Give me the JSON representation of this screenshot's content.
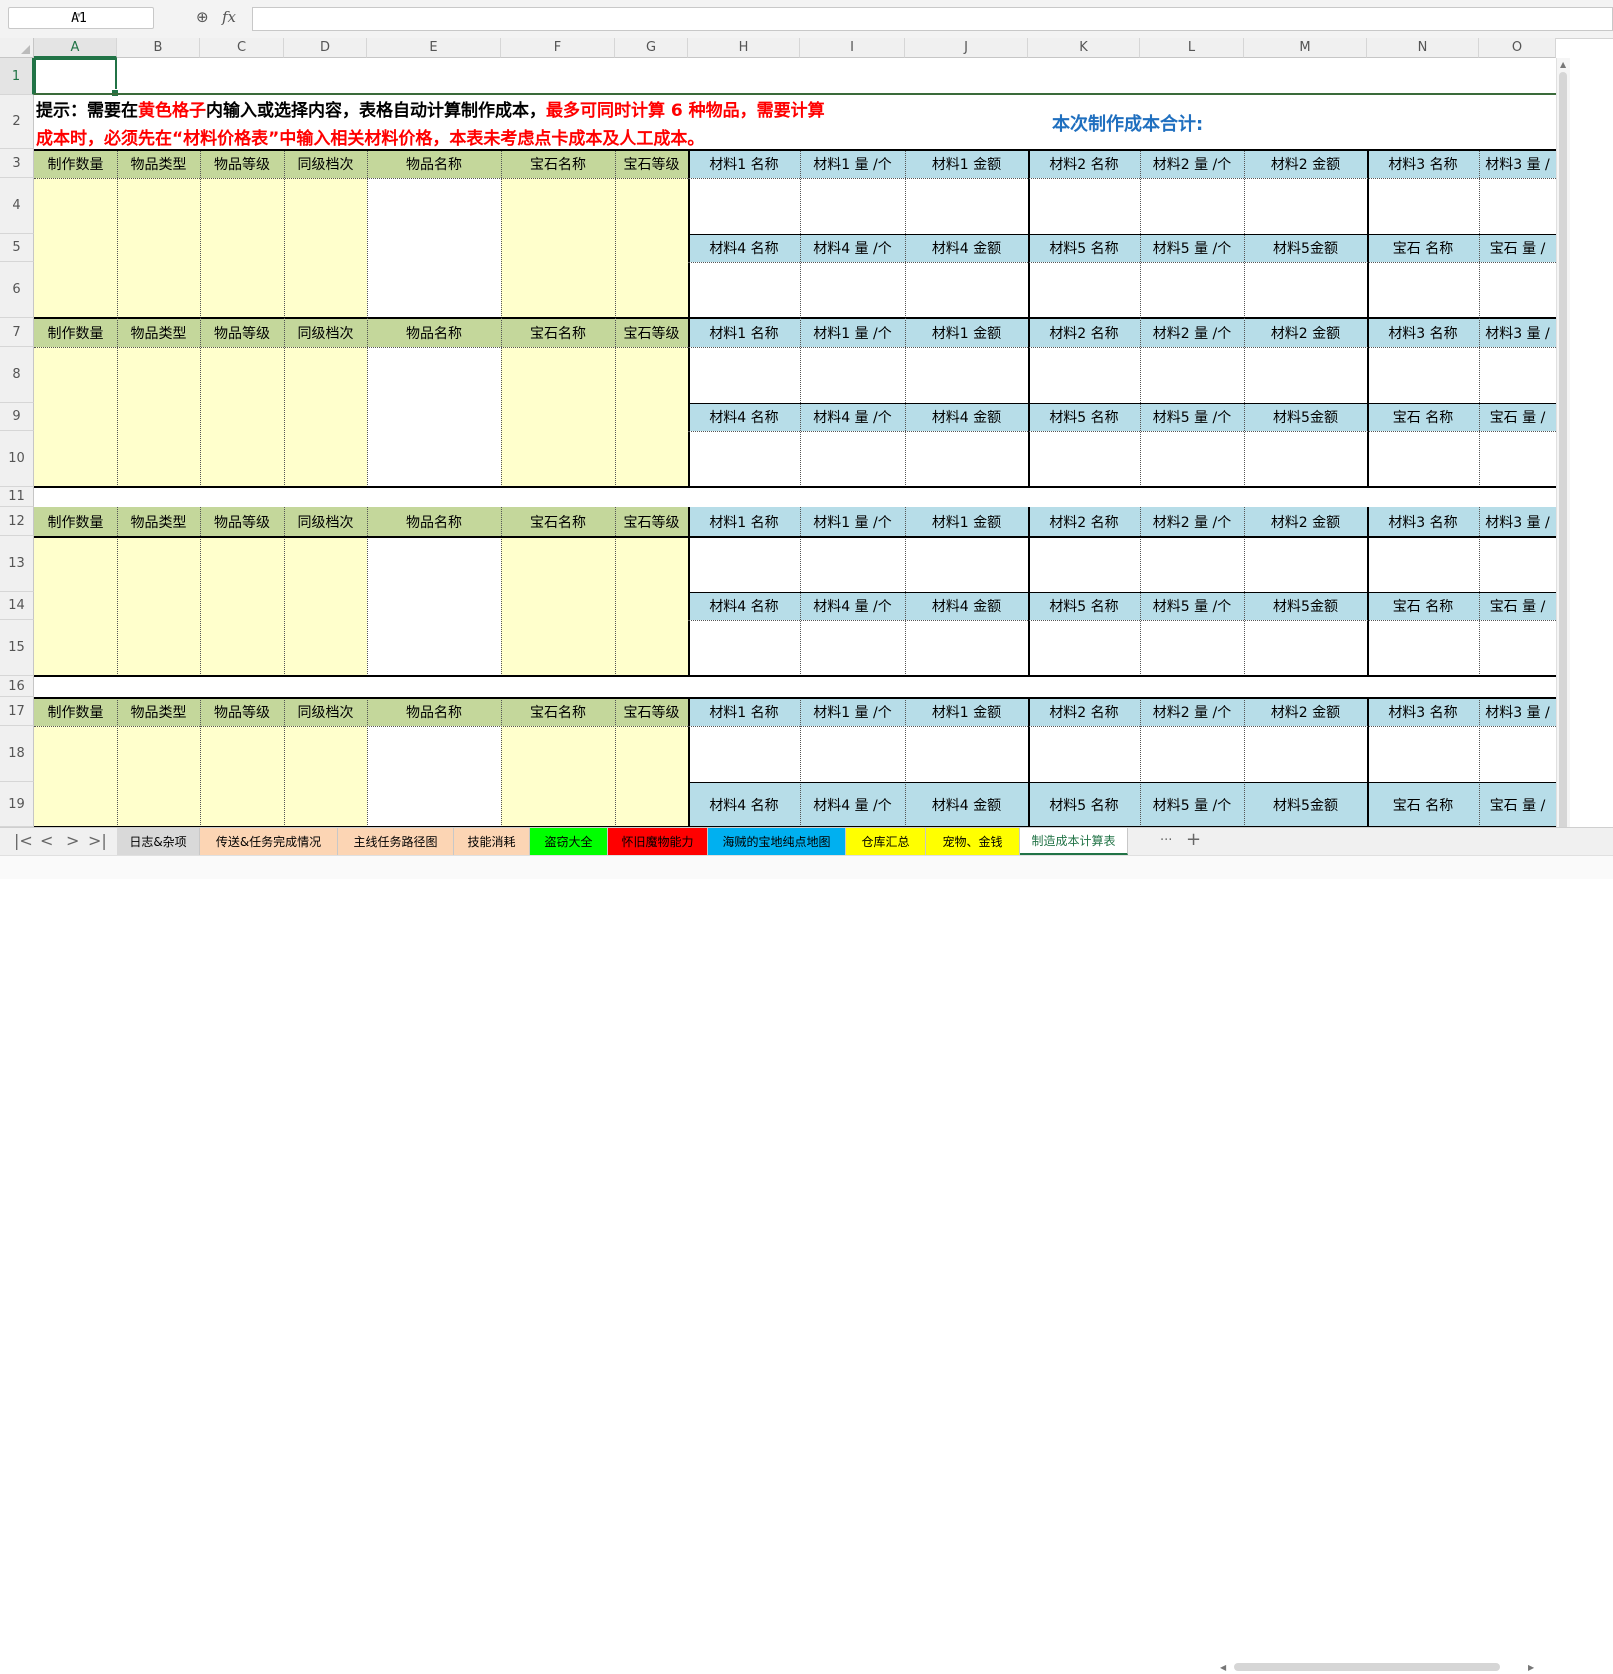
{
  "formula_bar": {
    "cell_ref": "A1",
    "fx_label": "fx",
    "formula": ""
  },
  "columns": [
    "A",
    "B",
    "C",
    "D",
    "E",
    "F",
    "G",
    "H",
    "I",
    "J",
    "K",
    "L",
    "M",
    "N",
    "O"
  ],
  "rows": [
    "1",
    "2",
    "3",
    "4",
    "5",
    "6",
    "7",
    "8",
    "9",
    "10",
    "11",
    "12",
    "13",
    "14",
    "15",
    "16",
    "17",
    "18",
    "19"
  ],
  "sheet": {
    "tip_line1_a": "提示：需要在",
    "tip_line1_b": "黄色格子",
    "tip_line1_c": "内输入或选择内容，表格自动计算制作成本，",
    "tip_line1_d": "最多可同时计算 6 种物品，需要计算",
    "tip_line2": "成本时，必须先在“材料价格表”中输入相关材料价格，本表未考虑点卡成本及人工成本。",
    "total_label": "本次制作成本合计:",
    "left_headers": [
      "制作数量",
      "物品类型",
      "物品等级",
      "同级档次",
      "物品名称",
      "宝石名称",
      "宝石等级"
    ],
    "right_headers_top": [
      "材料1 名称",
      "材料1 量 /个",
      "材料1 金额",
      "材料2 名称",
      "材料2 量 /个",
      "材料2 金额",
      "材料3 名称",
      "材料3 量 /"
    ],
    "right_headers_bottom": [
      "材料4 名称",
      "材料4 量 /个",
      "材料4 金额",
      "材料5 名称",
      "材料5 量 /个",
      "材料5金额",
      "宝石 名称",
      "宝石 量 /"
    ]
  },
  "tabs": [
    "日志&杂项",
    "传送&任务完成情况",
    "主线任务路径图",
    "技能消耗",
    "盗窃大全",
    "怀旧魔物能力",
    "海贼的宝地纯点地图",
    "仓库汇总",
    "宠物、金钱",
    "制造成本计算表"
  ],
  "tab_colors": [
    "#d9d9d9",
    "#fcd5b4",
    "#fcd5b4",
    "#fcd5b4",
    "#00ff00",
    "#ff0000",
    "#00b0f0",
    "#ffff00",
    "#ffff00",
    "#ffffff"
  ],
  "nav": {
    "first": "|<",
    "prev": "<",
    "next": ">",
    "last": ">|",
    "more": "···",
    "add": "+"
  }
}
